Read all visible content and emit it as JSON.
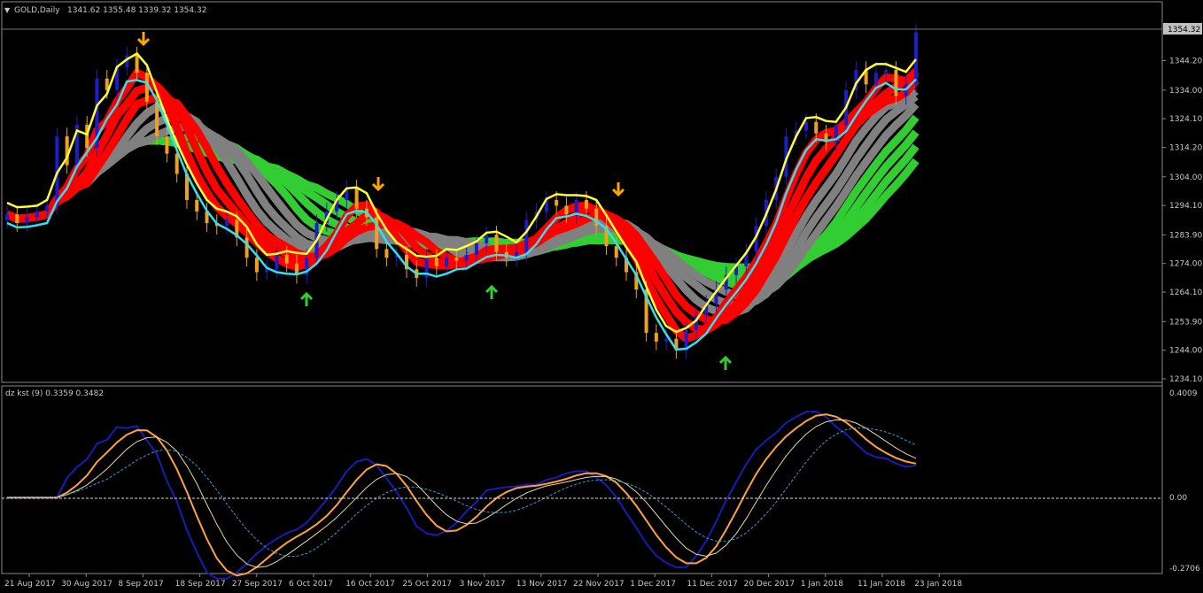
{
  "price_panel": {
    "symbol_label": "GOLD,Daily",
    "ohlc_text": "1341.62 1355.48 1339.32 1354.32",
    "current_price_tag": "1354.32",
    "y_ticks": [
      "1344.20",
      "1334.00",
      "1324.10",
      "1314.20",
      "1304.00",
      "1294.10",
      "1283.90",
      "1274.00",
      "1264.10",
      "1253.90",
      "1244.00",
      "1234.10"
    ]
  },
  "indicator_panel": {
    "title": "dz kst (9) 0.3359 0.3482",
    "y_ticks": [
      "0.4009",
      "0.00",
      "-0.2706"
    ]
  },
  "x_ticks": [
    "21 Aug 2017",
    "30 Aug 2017",
    "8 Sep 2017",
    "18 Sep 2017",
    "27 Sep 2017",
    "6 Oct 2017",
    "16 Oct 2017",
    "25 Oct 2017",
    "3 Nov 2017",
    "13 Nov 2017",
    "22 Nov 2017",
    "1 Dec 2017",
    "11 Dec 2017",
    "20 Dec 2017",
    "1 Jan 2018",
    "11 Jan 2018",
    "23 Jan 2018"
  ],
  "colors": {
    "background": "#000000",
    "bull_candle": "#1e1ec8",
    "bear_candle": "#f0a020",
    "band_red": "#ff0000",
    "band_gray": "#808080",
    "band_green": "#32cd32",
    "cyan_line": "#33e0f0",
    "yellow_line": "#ffff33",
    "signal_up": "#32cd32",
    "signal_down": "#ffa500",
    "kst_blue": "#1a1ab8",
    "kst_orange": "#ffa040",
    "grid": "#444444"
  },
  "chart_data": {
    "type": "line",
    "price_range": [
      1234.1,
      1355.48
    ],
    "indicator_range": [
      -0.2706,
      0.4009
    ],
    "signals": {
      "down_arrows_x_dates": [
        "8 Sep 2017",
        "16 Oct 2017",
        "22 Nov 2017"
      ],
      "up_arrows_x_dates": [
        "6 Oct 2017",
        "3 Nov 2017",
        "11 Dec 2017"
      ]
    },
    "candles_close_approx": [
      1291,
      1288,
      1290,
      1292,
      1294,
      1318,
      1308,
      1322,
      1314,
      1338,
      1334,
      1342,
      1346,
      1340,
      1330,
      1318,
      1312,
      1305,
      1296,
      1292,
      1288,
      1287,
      1289,
      1283,
      1276,
      1271,
      1272,
      1277,
      1274,
      1270,
      1276,
      1288,
      1292,
      1296,
      1300,
      1293,
      1290,
      1279,
      1276,
      1277,
      1272,
      1269,
      1276,
      1273,
      1276,
      1275,
      1277,
      1281,
      1284,
      1278,
      1276,
      1278,
      1289,
      1292,
      1296,
      1294,
      1291,
      1296,
      1293,
      1287,
      1280,
      1276,
      1271,
      1265,
      1250,
      1247,
      1248,
      1244,
      1251,
      1256,
      1260,
      1265,
      1270,
      1273,
      1278,
      1287,
      1296,
      1304,
      1318,
      1320,
      1323,
      1319,
      1316,
      1322,
      1334,
      1341,
      1336,
      1340,
      1341,
      1332,
      1336,
      1354
    ]
  }
}
